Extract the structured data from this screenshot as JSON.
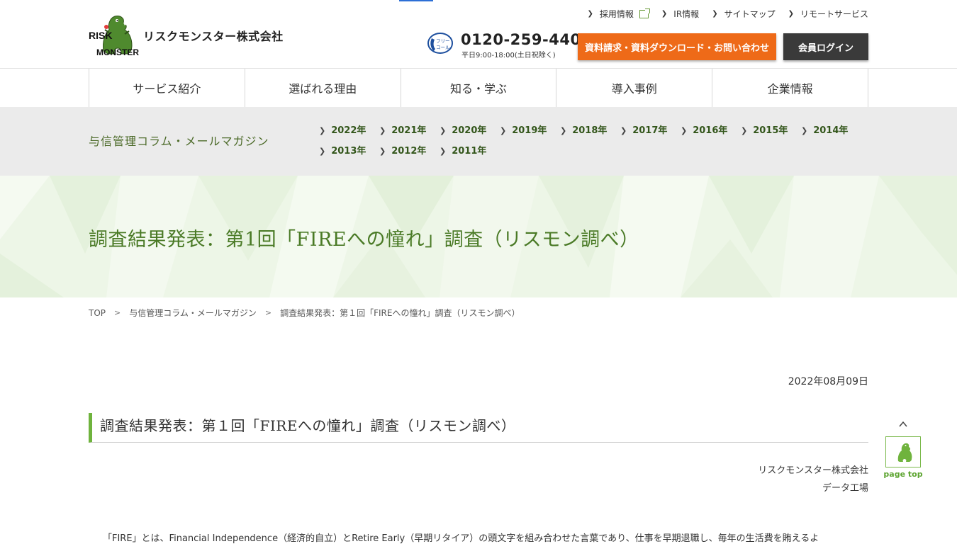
{
  "header": {
    "logo_text": "リスクモンスター株式会社",
    "logo_mark_line1": "RISK",
    "logo_mark_line2": "MONSTER",
    "utility_links": [
      {
        "label": "採用情報",
        "external": true
      },
      {
        "label": "IR情報",
        "external": false
      },
      {
        "label": "サイトマップ",
        "external": false
      },
      {
        "label": "リモートサービス",
        "external": false
      }
    ],
    "freecall_icon_text_1": "フリー",
    "freecall_icon_text_2": "コール",
    "phone_number": "0120-259-440",
    "phone_hours": "平日9:00-18:00(土日祝除く)",
    "request_button": "資料請求・資料ダウンロード・お問い合わせ",
    "login_button": "会員ログイン"
  },
  "gnav": {
    "items": [
      "サービス紹介",
      "選ばれる理由",
      "知る・学ぶ",
      "導入事例",
      "企業情報"
    ]
  },
  "column_bar": {
    "title": "与信管理コラム・メールマガジン",
    "years": [
      "2022年",
      "2021年",
      "2020年",
      "2019年",
      "2018年",
      "2017年",
      "2016年",
      "2015年",
      "2014年",
      "2013年",
      "2012年",
      "2011年"
    ]
  },
  "hero": {
    "title": "調査結果発表：第1回「FIREへの憧れ」調査（リスモン調べ）"
  },
  "breadcrumb": {
    "items": [
      "TOP",
      "与信管理コラム・メールマガジン",
      "調査結果発表：第１回「FIREへの憧れ」調査（リスモン調べ）"
    ]
  },
  "article": {
    "date": "2022年08月09日",
    "heading": "調査結果発表：第１回「FIREへの憧れ」調査（リスモン調べ）",
    "author_company": "リスクモンスター株式会社",
    "author_dept": "データ工場",
    "body_first_line": "「FIRE」とは、Financial Independence（経済的自立）とRetire Early（早期リタイア）の頭文字を組み合わせた言葉であり、仕事を早期退職し、毎年の生活費を賄えるよ"
  },
  "pagetop": {
    "label": "page top"
  },
  "colors": {
    "accent_green": "#6fb33d",
    "request_orange": "#ee6a18",
    "login_dark": "#3a3a3a",
    "hero_bg": "#edf6e7",
    "column_bar_bg": "#ebebeb"
  }
}
